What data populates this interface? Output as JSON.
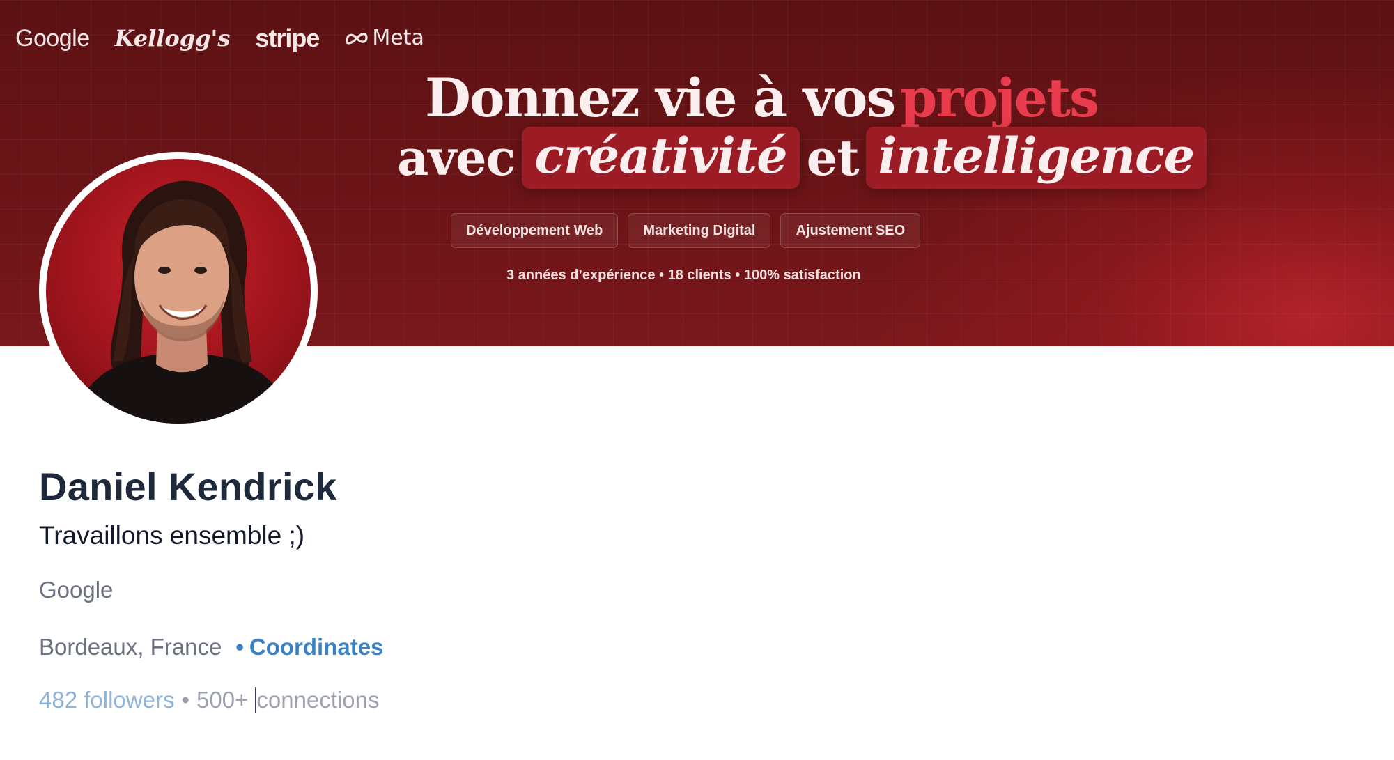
{
  "banner": {
    "logos": [
      "Google",
      "Kellogg's",
      "stripe",
      "Meta"
    ],
    "headline_line1": "Donnez vie à vos",
    "headline_accent": "projets",
    "headline_avec": "avec",
    "headline_word1": "créativité",
    "headline_et": "et",
    "headline_word2": "intelligence",
    "tags": [
      "Développement Web",
      "Marketing Digital",
      "Ajustement SEO"
    ],
    "stats": "3 années d’expérience • 18 clients • 100% satisfaction"
  },
  "profile": {
    "name": "Daniel Kendrick",
    "headline": "Travaillons ensemble ;)",
    "company": "Google",
    "location": "Bordeaux, France",
    "separator": "•",
    "coordinates_label": "Coordinates",
    "followers": "482 followers",
    "network_separator": "•",
    "connections_count": "500+",
    "connections_label": "connections"
  },
  "colors": {
    "banner_dark": "#5c1113",
    "banner_accent": "#e83c4c",
    "link": "#3b82c4",
    "followers_link": "#8fb3d9"
  }
}
